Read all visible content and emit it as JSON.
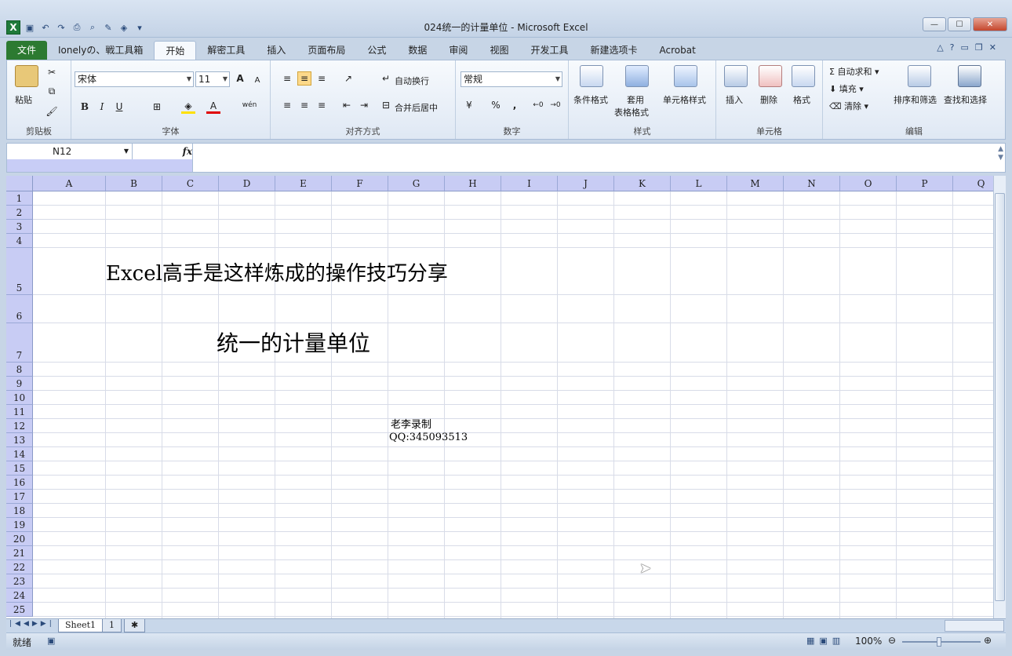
{
  "window": {
    "title": "024统一的计量单位 - Microsoft Excel",
    "controls": {
      "minimize": "—",
      "maximize": "☐",
      "close": "✕"
    }
  },
  "ribbon_tabs": [
    "文件",
    "Ionelyの、戦工具箱",
    "开始",
    "解密工具",
    "插入",
    "页面布局",
    "公式",
    "数据",
    "审阅",
    "视图",
    "开发工具",
    "新建选项卡",
    "Acrobat"
  ],
  "active_tab": "开始",
  "ribbon": {
    "clipboard": {
      "paste": "粘贴",
      "label": "剪贴板"
    },
    "font": {
      "name": "宋体",
      "size": "11",
      "bold": "B",
      "italic": "I",
      "underline": "U",
      "label": "字体",
      "grow": "A",
      "shrink": "A",
      "font_color": "A",
      "phonetic": "wén"
    },
    "alignment": {
      "wrap": "自动换行",
      "merge": "合并后居中",
      "label": "对齐方式"
    },
    "number": {
      "format": "常规",
      "percent": "%",
      "comma": ",",
      "label": "数字"
    },
    "styles": {
      "conditional": "条件格式",
      "table_format_1": "套用",
      "table_format_2": "表格格式",
      "cell_styles": "单元格样式",
      "label": "样式"
    },
    "cells": {
      "insert": "插入",
      "delete": "删除",
      "format": "格式",
      "label": "单元格"
    },
    "editing": {
      "autosum": "自动求和",
      "fill": "填充",
      "clear": "清除",
      "sort_filter": "排序和筛选",
      "find_select": "查找和选择",
      "label": "编辑"
    }
  },
  "formula_bar": {
    "name_box": "N12",
    "fx": "fx",
    "formula": ""
  },
  "columns": [
    "A",
    "B",
    "C",
    "D",
    "E",
    "F",
    "G",
    "H",
    "I",
    "J",
    "K",
    "L",
    "M",
    "N",
    "O",
    "P",
    "Q"
  ],
  "rows": [
    "1",
    "2",
    "3",
    "4",
    "5",
    "6",
    "7",
    "8",
    "9",
    "10",
    "11",
    "12",
    "13",
    "14",
    "15",
    "16",
    "17",
    "18",
    "19",
    "20",
    "21",
    "22",
    "23",
    "24",
    "25"
  ],
  "cells": {
    "B5": "Excel高手是这样炼成的操作技巧分享",
    "D7": "统一的计量单位",
    "G12": "老李录制",
    "G13": "QQ:345093513"
  },
  "sheets": [
    "Sheet1",
    "1"
  ],
  "status": {
    "mode": "就绪",
    "zoom": "100%"
  }
}
